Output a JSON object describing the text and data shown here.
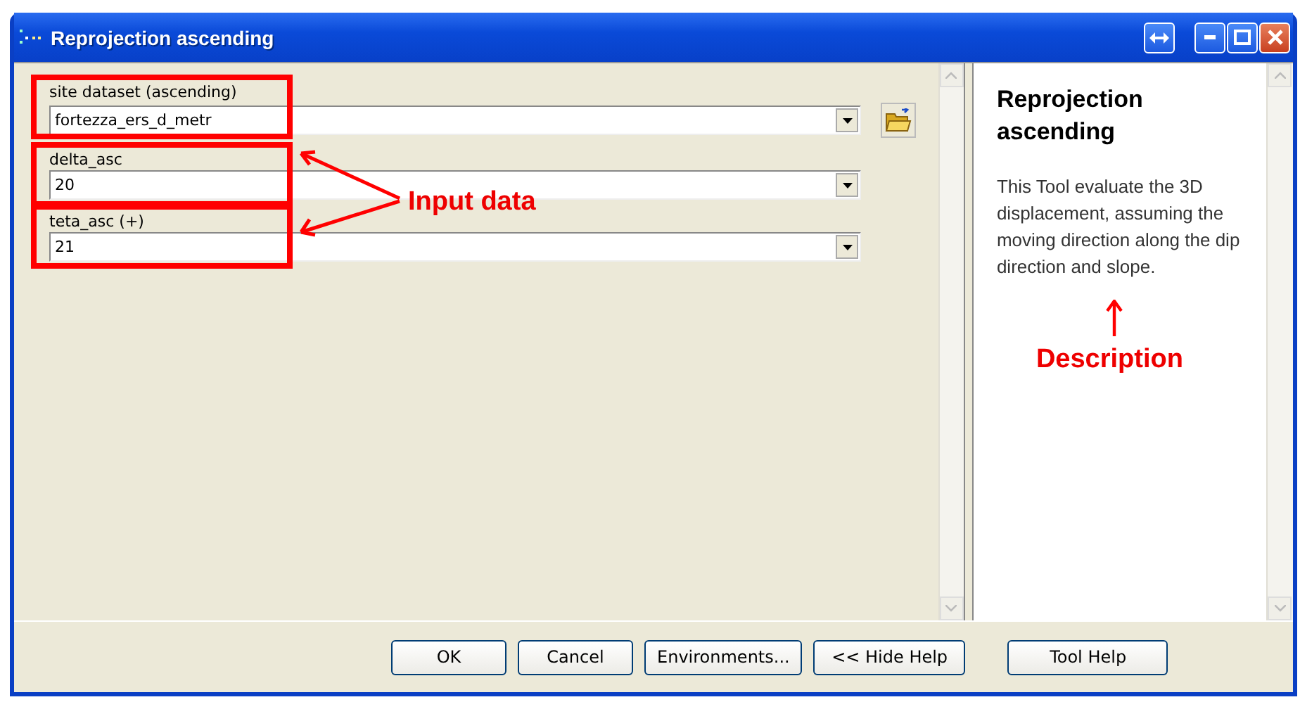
{
  "window": {
    "title": "Reprojection ascending"
  },
  "fields": [
    {
      "label": "site dataset (ascending)",
      "value": "fortezza_ers_d_metr",
      "browse": true
    },
    {
      "label": "delta_asc",
      "value": "20",
      "browse": false
    },
    {
      "label": "teta_asc (+)",
      "value": "21",
      "browse": false
    }
  ],
  "help": {
    "title": "Reprojection ascending",
    "text": "This Tool evaluate the 3D displacement, assuming the moving direction along the dip direction and slope."
  },
  "annotations": {
    "input_label": "Input data",
    "description_label": "Description"
  },
  "buttons": [
    "OK",
    "Cancel",
    "Environments...",
    "<< Hide Help",
    "Tool Help"
  ]
}
